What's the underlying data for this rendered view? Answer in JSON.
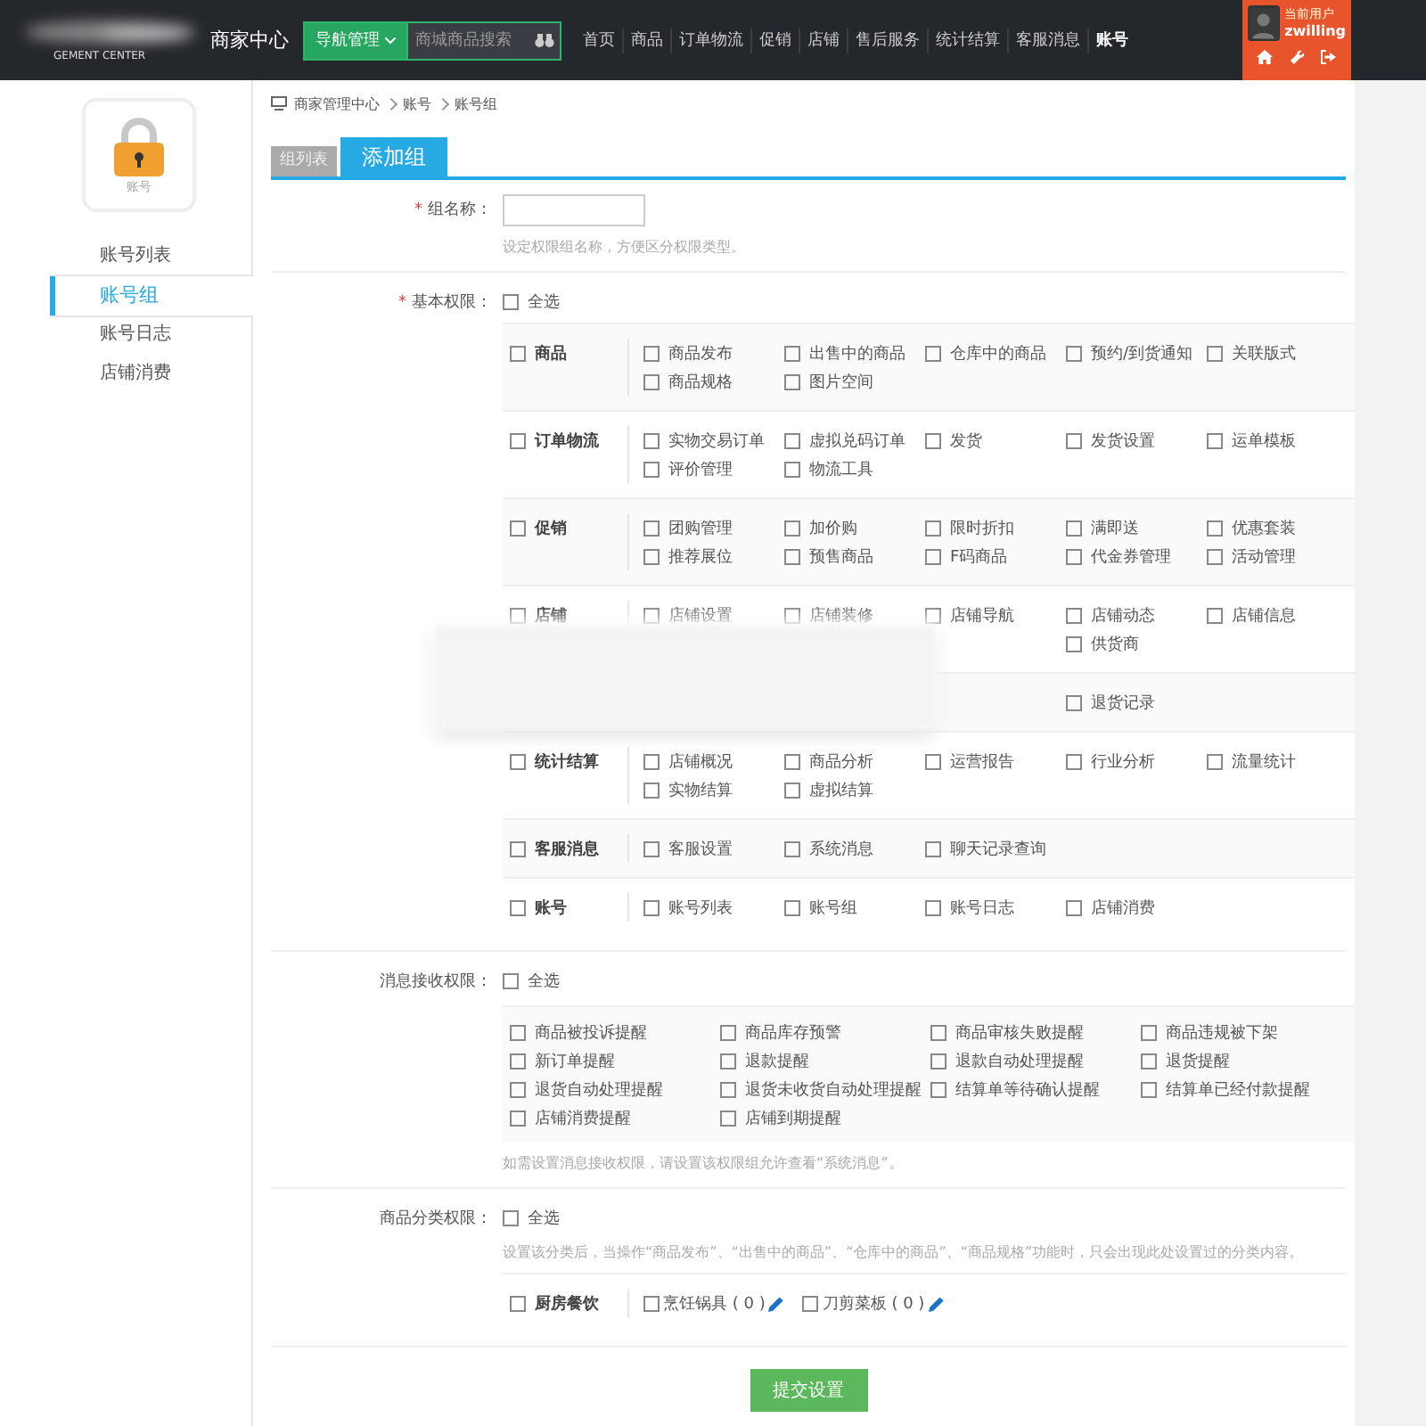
{
  "header": {
    "logo_subtitle": "GEMENT CENTER",
    "title": "商家中心",
    "nav_button": "导航管理",
    "search": {
      "placeholder": "商城商品搜索"
    },
    "nav": [
      {
        "label": "首页",
        "selected": false
      },
      {
        "label": "商品",
        "selected": false
      },
      {
        "label": "订单物流",
        "selected": false
      },
      {
        "label": "促销",
        "selected": false
      },
      {
        "label": "店铺",
        "selected": false
      },
      {
        "label": "售后服务",
        "selected": false
      },
      {
        "label": "统计结算",
        "selected": false
      },
      {
        "label": "客服消息",
        "selected": false
      },
      {
        "label": "账号",
        "selected": true
      }
    ],
    "user": {
      "caption": "当前用户",
      "name": "zwilling"
    }
  },
  "sidebar": {
    "icon_label": "账号",
    "items": [
      {
        "label": "账号列表",
        "selected": false
      },
      {
        "label": "账号组",
        "selected": true
      },
      {
        "label": "账号日志",
        "selected": false
      },
      {
        "label": "店铺消费",
        "selected": false
      }
    ]
  },
  "breadcrumb": [
    "商家管理中心",
    "账号",
    "账号组"
  ],
  "tabs": [
    {
      "label": "组列表",
      "selected": false
    },
    {
      "label": "添加组",
      "selected": true
    }
  ],
  "group_name": {
    "label": "组名称：",
    "required_mark": "*",
    "hint": "设定权限组名称，方便区分权限类型。"
  },
  "basic_permissions": {
    "label": "基本权限：",
    "required_mark": "*",
    "select_all": {
      "label": "全选",
      "checked": false
    },
    "groups": [
      {
        "name": "商品",
        "checked": false,
        "items": [
          {
            "label": "商品发布",
            "checked": false
          },
          {
            "label": "出售中的商品",
            "checked": false
          },
          {
            "label": "仓库中的商品",
            "checked": false
          },
          {
            "label": "预约/到货通知",
            "checked": false
          },
          {
            "label": "关联版式",
            "checked": false
          },
          {
            "label": "商品规格",
            "checked": false
          },
          {
            "label": "图片空间",
            "checked": false
          }
        ]
      },
      {
        "name": "订单物流",
        "checked": false,
        "items": [
          {
            "label": "实物交易订单",
            "checked": false
          },
          {
            "label": "虚拟兑码订单",
            "checked": false
          },
          {
            "label": "发货",
            "checked": false
          },
          {
            "label": "发货设置",
            "checked": false
          },
          {
            "label": "运单模板",
            "checked": false
          },
          {
            "label": "评价管理",
            "checked": false
          },
          {
            "label": "物流工具",
            "checked": false
          }
        ]
      },
      {
        "name": "促销",
        "checked": false,
        "items": [
          {
            "label": "团购管理",
            "checked": false
          },
          {
            "label": "加价购",
            "checked": false
          },
          {
            "label": "限时折扣",
            "checked": false
          },
          {
            "label": "满即送",
            "checked": false
          },
          {
            "label": "优惠套装",
            "checked": false
          },
          {
            "label": "推荐展位",
            "checked": false
          },
          {
            "label": "预售商品",
            "checked": false
          },
          {
            "label": "F码商品",
            "checked": false
          },
          {
            "label": "代金券管理",
            "checked": false
          },
          {
            "label": "活动管理",
            "checked": false
          }
        ]
      },
      {
        "name": "店铺",
        "checked": false,
        "items": [
          {
            "label": "店铺设置",
            "checked": false
          },
          {
            "label": "店铺装修",
            "checked": false
          },
          {
            "label": "店铺导航",
            "checked": false
          },
          {
            "label": "店铺动态",
            "checked": false
          },
          {
            "label": "店铺信息",
            "checked": false
          },
          {
            "kind": "covered"
          },
          {
            "kind": "covered"
          },
          {
            "kind": "covered"
          },
          {
            "label": "供货商",
            "checked": false
          }
        ]
      },
      {
        "items": [
          {
            "kind": "covered"
          },
          {
            "kind": "covered"
          },
          {
            "kind": "covered"
          },
          {
            "label": "退货记录",
            "checked": false
          }
        ]
      },
      {
        "name": "统计结算",
        "checked": false,
        "items": [
          {
            "label": "店铺概况",
            "checked": false
          },
          {
            "label": "商品分析",
            "checked": false
          },
          {
            "label": "运营报告",
            "checked": false
          },
          {
            "label": "行业分析",
            "checked": false
          },
          {
            "label": "流量统计",
            "checked": false
          },
          {
            "label": "实物结算",
            "checked": false
          },
          {
            "label": "虚拟结算",
            "checked": false
          }
        ]
      },
      {
        "name": "客服消息",
        "checked": false,
        "items": [
          {
            "label": "客服设置",
            "checked": false
          },
          {
            "label": "系统消息",
            "checked": false
          },
          {
            "label": "聊天记录查询",
            "checked": false
          }
        ]
      },
      {
        "name": "账号",
        "checked": false,
        "items": [
          {
            "label": "账号列表",
            "checked": false
          },
          {
            "label": "账号组",
            "checked": false
          },
          {
            "label": "账号日志",
            "checked": false
          },
          {
            "label": "店铺消费",
            "checked": false
          }
        ]
      }
    ]
  },
  "message_permissions": {
    "label": "消息接收权限：",
    "select_all": {
      "label": "全选",
      "checked": false
    },
    "items": [
      {
        "label": "商品被投诉提醒",
        "checked": false
      },
      {
        "label": "商品库存预警",
        "checked": false
      },
      {
        "label": "商品审核失败提醒",
        "checked": false
      },
      {
        "label": "商品违规被下架",
        "checked": false
      },
      {
        "label": "新订单提醒",
        "checked": false
      },
      {
        "label": "退款提醒",
        "checked": false
      },
      {
        "label": "退款自动处理提醒",
        "checked": false
      },
      {
        "label": "退货提醒",
        "checked": false
      },
      {
        "label": "退货自动处理提醒",
        "checked": false
      },
      {
        "label": "退货未收货自动处理提醒",
        "checked": false
      },
      {
        "label": "结算单等待确认提醒",
        "checked": false
      },
      {
        "label": "结算单已经付款提醒",
        "checked": false
      },
      {
        "label": "店铺消费提醒",
        "checked": false
      },
      {
        "label": "店铺到期提醒",
        "checked": false
      }
    ],
    "hint": "如需设置消息接收权限，请设置该权限组允许查看“系统消息”。"
  },
  "category_permissions": {
    "label": "商品分类权限：",
    "select_all": {
      "label": "全选",
      "checked": false
    },
    "hint": "设置该分类后，当操作“商品发布”、“出售中的商品”、“仓库中的商品”、“商品规格”功能时，只会出现此处设置过的分类内容。",
    "categories": [
      {
        "name": "厨房餐饮",
        "checked": false,
        "children": [
          {
            "label": "烹饪锅具 ( 0 )",
            "checked": false
          },
          {
            "label": "刀剪菜板 ( 0 )",
            "checked": false
          }
        ]
      }
    ]
  },
  "submit_button": "提交设置"
}
